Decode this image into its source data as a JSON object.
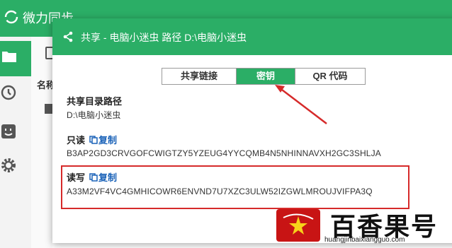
{
  "app": {
    "title": "微力同步"
  },
  "dialog": {
    "title": "共享 - 电脑小迷虫 路径 D:\\电脑小迷虫",
    "tabs": [
      {
        "label": "共享链接",
        "active": false
      },
      {
        "label": "密钥",
        "active": true
      },
      {
        "label": "QR 代码",
        "active": false
      }
    ],
    "share_path_label": "共享目录路径",
    "share_path_value": "D:\\电脑小迷虫",
    "readonly_label": "只读",
    "readonly_copy": "复制",
    "readonly_key": "B3AP2GD3CRVGOFCWIGTZY5YZEUG4YYCQMB4N5NHINNAVXH2GC3SHLJA",
    "readwrite_label": "读写",
    "readwrite_copy": "复制",
    "readwrite_key": "A33M2VF4VC4GMHICOWR6ENVND7U7XZC3ULW52IZGWLMROUJVIFPA3Q"
  },
  "background": {
    "list_header": "名称"
  },
  "watermark": {
    "brand": "百香果号",
    "url": "huangjinbaixiangguo.com"
  },
  "colors": {
    "accent": "#2bae66",
    "highlight": "#d62a2a",
    "link": "#1a62b8"
  }
}
